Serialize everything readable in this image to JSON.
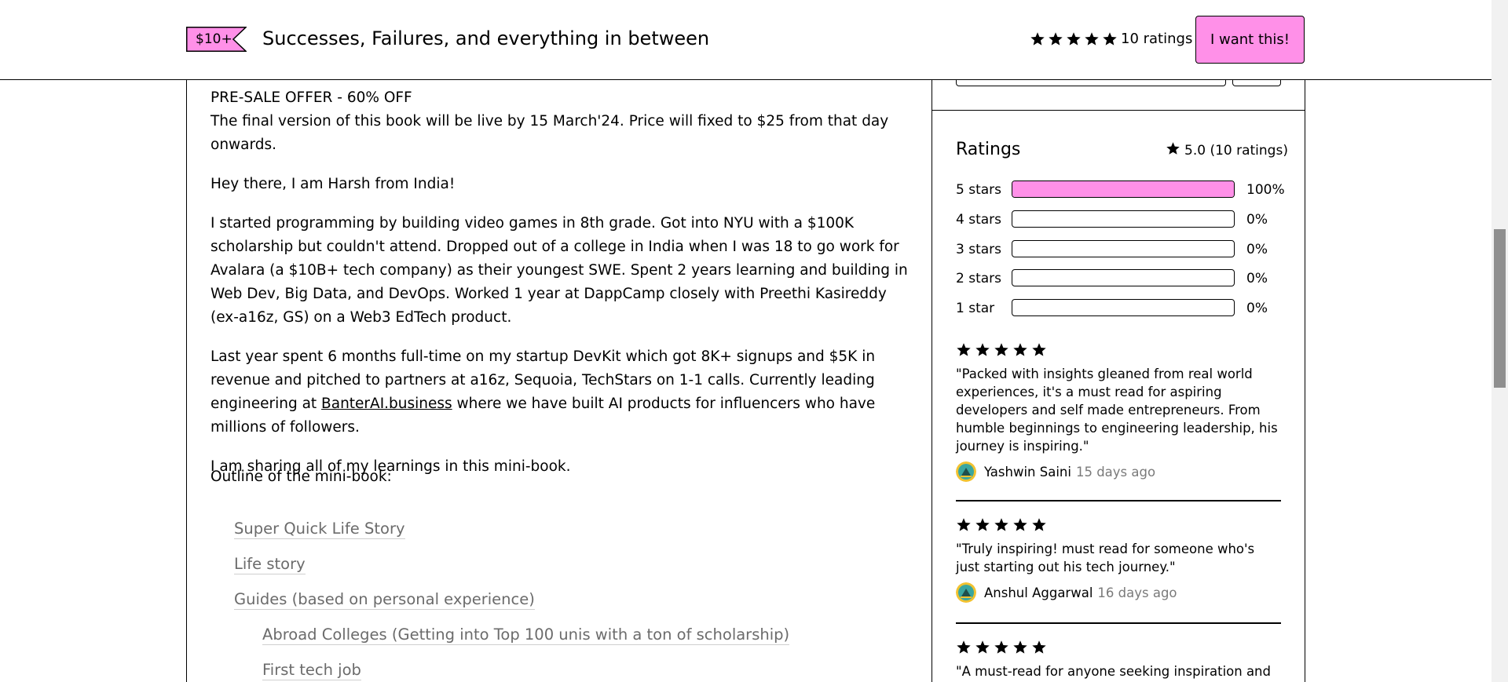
{
  "header": {
    "price_tag": "$10+",
    "title": "Successes, Failures, and everything in between",
    "rating_stars": 5,
    "ratings_count": "10 ratings",
    "cta": "I want this!"
  },
  "description": {
    "offer_title": "PRE-SALE OFFER - 60% OFF",
    "offer_text": "The final version of this book will be live by 15 March'24. Price will fixed to $25 from that day onwards.",
    "p1": "Hey there, I am Harsh from India!",
    "p2": "I started programming by building video games in 8th grade. Got into NYU with a $100K scholarship but couldn't attend. Dropped out of a college in India when I was 18 to go work for Avalara (a $10B+ tech company) as their youngest SWE. Spent 2 years learning and building in Web Dev, Big Data, and DevOps. Worked 1 year at DappCamp closely with Preethi Kasireddy (ex-a16z, GS) on a Web3 EdTech product.",
    "p3_before": "Last year spent 6 months full-time on my startup DevKit which got 8K+ signups and $5K in revenue and pitched to partners at a16z, Sequoia, TechStars on 1-1 calls. Currently leading engineering at ",
    "p3_link": "BanterAI.business",
    "p3_after": " where we have built AI products for influencers who have millions of followers.",
    "p4": "I am sharing all of my learnings in this mini-book.",
    "outline_label": "Outline of the mini-book:",
    "toc": [
      "Super Quick Life Story",
      "Life story",
      "Guides (based on personal experience)",
      "Abroad Colleges (Getting into Top 100 unis with a ton of scholarship)",
      "First tech job"
    ]
  },
  "ratings": {
    "title": "Ratings",
    "average": "5.0 (10 ratings)",
    "distribution": [
      {
        "label": "5 stars",
        "percent": "100%",
        "fraction": 1.0
      },
      {
        "label": "4 stars",
        "percent": "0%",
        "fraction": 0
      },
      {
        "label": "3 stars",
        "percent": "0%",
        "fraction": 0
      },
      {
        "label": "2 stars",
        "percent": "0%",
        "fraction": 0
      },
      {
        "label": "1 star",
        "percent": "0%",
        "fraction": 0
      }
    ]
  },
  "reviews": [
    {
      "stars": 5,
      "text": "\"Packed with insights gleaned from real world experiences, it's a must read for aspiring developers and self made entrepreneurs. From humble beginnings to engineering leadership, his journey is inspiring.\"",
      "author": "Yashwin Saini",
      "time": "15 days ago"
    },
    {
      "stars": 5,
      "text": "\"Truly inspiring! must read for someone who's just starting out his tech journey.\"",
      "author": "Anshul Aggarwal",
      "time": "16 days ago"
    },
    {
      "stars": 5,
      "text": "\"A must-read for anyone seeking inspiration and",
      "author": "",
      "time": ""
    }
  ],
  "colors": {
    "accent_pink": "#ff90e8",
    "muted_text": "#7a7a7a",
    "toc_link": "#6b6b6b"
  },
  "icons": {
    "star": "star-icon",
    "avatar": "avatar"
  }
}
